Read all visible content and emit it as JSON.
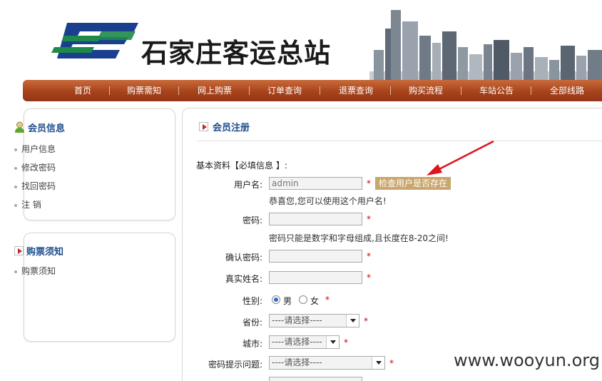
{
  "header": {
    "site_name": "石家庄客运总站"
  },
  "nav": {
    "items": [
      "首页",
      "购票需知",
      "网上购票",
      "订单查询",
      "退票查询",
      "购买流程",
      "车站公告",
      "全部线路"
    ]
  },
  "sidebar": {
    "member_title": "会员信息",
    "member_items": [
      "用户信息",
      "修改密码",
      "找回密码",
      "注 销"
    ],
    "ticket_title": "购票须知",
    "ticket_items": [
      "购票须知"
    ]
  },
  "main": {
    "title": "会员注册",
    "section_label": "基本资料【必填信息 】:",
    "username_label": "用户名:",
    "username_value": "admin",
    "check_button": "检查用户是否存在",
    "username_hint": "恭喜您,您可以使用这个用户名!",
    "password_label": "密码:",
    "password_hint": "密码只能是数字和字母组成,且长度在8-20之间!",
    "confirm_label": "确认密码:",
    "realname_label": "真实姓名:",
    "gender_label": "性别:",
    "gender_male": "男",
    "gender_female": "女",
    "gender_selected": "男",
    "province_label": "省份:",
    "province_value": "----请选择----",
    "city_label": "城市:",
    "city_value": "----请选择----",
    "question_label": "密码提示问题:",
    "question_value": "----请选择----",
    "required_mark": "*"
  },
  "watermark": "www.wooyun.org",
  "colors": {
    "nav_bg": "#a8431b",
    "title_blue": "#1f4e8c",
    "required_red": "#d10000",
    "button_tan": "#c9a66b",
    "arrow_red": "#e0141e"
  }
}
